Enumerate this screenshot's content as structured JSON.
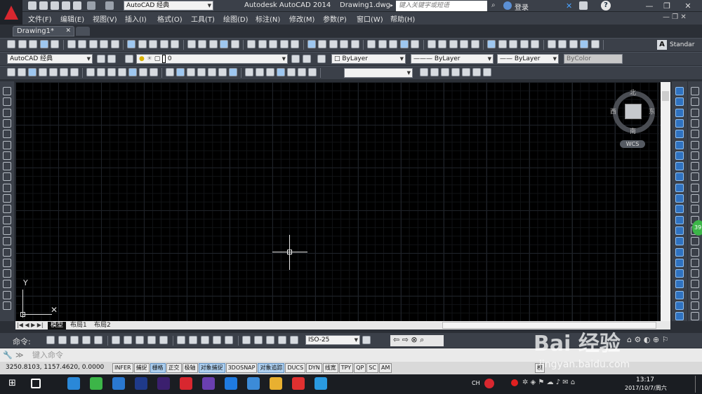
{
  "window": {
    "title": "Autodesk AutoCAD 2014",
    "file": "Drawing1.dwg",
    "workspace": "AutoCAD 经典",
    "search_placeholder": "键入关键字或短语",
    "login": "登录"
  },
  "menu": [
    "文件(F)",
    "编辑(E)",
    "视图(V)",
    "插入(I)",
    "格式(O)",
    "工具(T)",
    "绘图(D)",
    "标注(N)",
    "修改(M)",
    "参数(P)",
    "窗口(W)",
    "帮助(H)"
  ],
  "doc_tab": "Drawing1*",
  "toolbar": {
    "workspace": "AutoCAD 经典",
    "layer": "0",
    "color": "ByLayer",
    "linetype": "ByLayer",
    "lineweight": "ByLayer",
    "plotstyle": "ByColor",
    "textstyle": "Standar",
    "dimstyle": "ISO-25"
  },
  "viewcube": {
    "north": "北",
    "south": "南",
    "east": "东",
    "west": "西",
    "wcs": "WCS"
  },
  "ucs": {
    "y": "Y"
  },
  "layout_tabs": [
    "模型",
    "布局1",
    "布局2"
  ],
  "command": {
    "label": "命令:",
    "placeholder": "键入命令"
  },
  "status": {
    "coords": "3250.8103, 1157.4620, 0.0000",
    "buttons": [
      "INFER",
      "捕捉",
      "栅格",
      "正交",
      "极轴",
      "对象捕捉",
      "3DOSNAP",
      "对象追踪",
      "DUCS",
      "DYN",
      "线宽",
      "TPY",
      "QP",
      "SC",
      "AM"
    ],
    "on": [
      2,
      5,
      7
    ],
    "model": "模"
  },
  "taskbar": {
    "lang": "CH",
    "time": "13:17",
    "date": "2017/10/7/周六"
  },
  "watermark": {
    "main": "Bai 经验",
    "sub": "jingyan.baidu.com"
  },
  "badge": "39"
}
